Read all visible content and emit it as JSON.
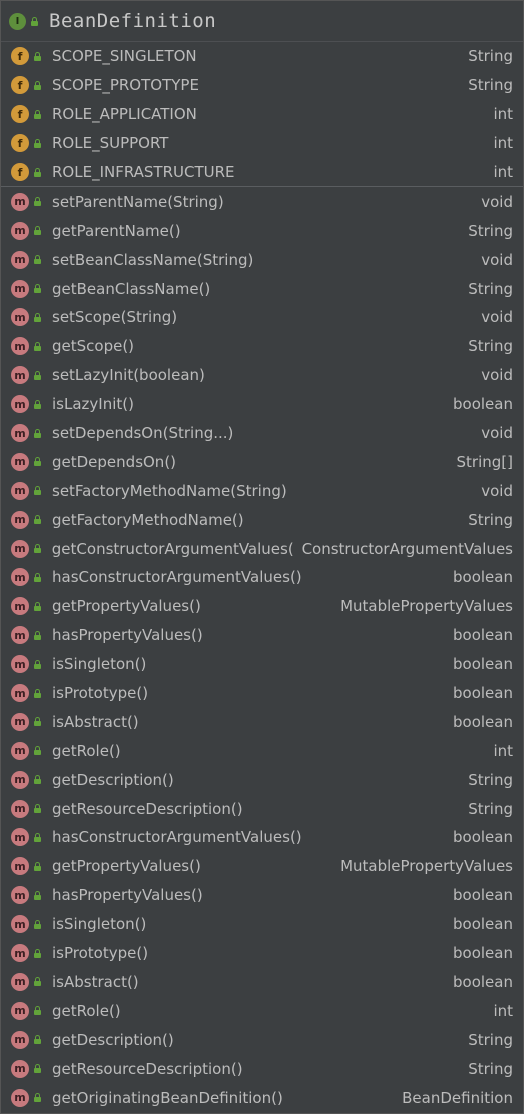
{
  "header": {
    "interface_badge": "I",
    "title": "BeanDefinition"
  },
  "colors": {
    "background": "#3c3f41",
    "method_icon": "#c77a7e",
    "field_icon": "#d29a3a",
    "interface_icon": "#5e8f3c",
    "lock_icon": "#62a33a"
  },
  "fields": [
    {
      "name": "SCOPE_SINGLETON",
      "type": "String",
      "icon": "f"
    },
    {
      "name": "SCOPE_PROTOTYPE",
      "type": "String",
      "icon": "f"
    },
    {
      "name": "ROLE_APPLICATION",
      "type": "int",
      "icon": "f"
    },
    {
      "name": "ROLE_SUPPORT",
      "type": "int",
      "icon": "f"
    },
    {
      "name": "ROLE_INFRASTRUCTURE",
      "type": "int",
      "icon": "f"
    }
  ],
  "methods": [
    {
      "name": "setParentName(String)",
      "type": "void",
      "icon": "m"
    },
    {
      "name": "getParentName()",
      "type": "String",
      "icon": "m"
    },
    {
      "name": "setBeanClassName(String)",
      "type": "void",
      "icon": "m"
    },
    {
      "name": "getBeanClassName()",
      "type": "String",
      "icon": "m"
    },
    {
      "name": "setScope(String)",
      "type": "void",
      "icon": "m"
    },
    {
      "name": "getScope()",
      "type": "String",
      "icon": "m"
    },
    {
      "name": "setLazyInit(boolean)",
      "type": "void",
      "icon": "m"
    },
    {
      "name": "isLazyInit()",
      "type": "boolean",
      "icon": "m"
    },
    {
      "name": "setDependsOn(String...)",
      "type": "void",
      "icon": "m"
    },
    {
      "name": "getDependsOn()",
      "type": "String[]",
      "icon": "m"
    },
    {
      "name": "setFactoryMethodName(String)",
      "type": "void",
      "icon": "m"
    },
    {
      "name": "getFactoryMethodName()",
      "type": "String",
      "icon": "m"
    },
    {
      "name": "getConstructorArgumentValues()",
      "type": "ConstructorArgumentValues",
      "icon": "m"
    },
    {
      "name": "hasConstructorArgumentValues()",
      "type": "boolean",
      "icon": "m"
    },
    {
      "name": "getPropertyValues()",
      "type": "MutablePropertyValues",
      "icon": "m"
    },
    {
      "name": "hasPropertyValues()",
      "type": "boolean",
      "icon": "m"
    },
    {
      "name": "isSingleton()",
      "type": "boolean",
      "icon": "m"
    },
    {
      "name": "isPrototype()",
      "type": "boolean",
      "icon": "m"
    },
    {
      "name": "isAbstract()",
      "type": "boolean",
      "icon": "m"
    },
    {
      "name": "getRole()",
      "type": "int",
      "icon": "m"
    },
    {
      "name": "getDescription()",
      "type": "String",
      "icon": "m"
    },
    {
      "name": "getResourceDescription()",
      "type": "String",
      "icon": "m"
    },
    {
      "name": "hasConstructorArgumentValues()",
      "type": "boolean",
      "icon": "m"
    },
    {
      "name": "getPropertyValues()",
      "type": "MutablePropertyValues",
      "icon": "m"
    },
    {
      "name": "hasPropertyValues()",
      "type": "boolean",
      "icon": "m"
    },
    {
      "name": "isSingleton()",
      "type": "boolean",
      "icon": "m"
    },
    {
      "name": "isPrototype()",
      "type": "boolean",
      "icon": "m"
    },
    {
      "name": "isAbstract()",
      "type": "boolean",
      "icon": "m"
    },
    {
      "name": "getRole()",
      "type": "int",
      "icon": "m"
    },
    {
      "name": "getDescription()",
      "type": "String",
      "icon": "m"
    },
    {
      "name": "getResourceDescription()",
      "type": "String",
      "icon": "m"
    },
    {
      "name": "getOriginatingBeanDefinition()",
      "type": "BeanDefinition",
      "icon": "m"
    }
  ]
}
